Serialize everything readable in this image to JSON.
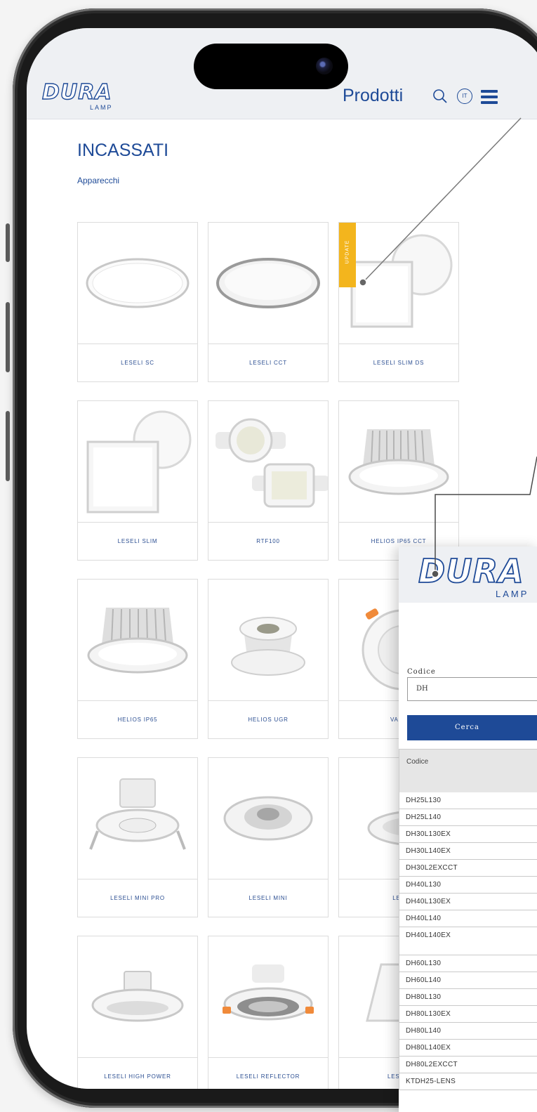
{
  "header": {
    "logo_text": "DURA",
    "logo_sub": "LAMP",
    "nav_title": "Prodotti",
    "lang_label": "IT"
  },
  "page": {
    "title": "INCASSATI",
    "breadcrumb": "Apparecchi"
  },
  "products": [
    {
      "label": "LESELI SC"
    },
    {
      "label": "LESELI CCT"
    },
    {
      "label": "LESELI SLIM DS",
      "badge": "UPDATE"
    },
    {
      "label": "LESELI SLIM"
    },
    {
      "label": "RTF100"
    },
    {
      "label": "HELIOS IP65 CCT"
    },
    {
      "label": "HELIOS IP65"
    },
    {
      "label": "HELIOS UGR"
    },
    {
      "label": "VALO"
    },
    {
      "label": "LESELI MINI PRO"
    },
    {
      "label": "LESELI MINI"
    },
    {
      "label": "LES"
    },
    {
      "label": "LESELI HIGH POWER"
    },
    {
      "label": "LESELI REFLECTOR"
    },
    {
      "label": "LESELI"
    }
  ],
  "search_panel": {
    "logo_text": "DURA",
    "logo_sub": "LAMP",
    "field_label": "Codice",
    "field_value": "DH",
    "button_label": "Cerca",
    "column_header": "Codice",
    "rows": [
      "DH25L130",
      "DH25L140",
      "DH30L130EX",
      "DH30L140EX",
      "DH30L2EXCCT",
      "DH40L130",
      "DH40L130EX",
      "DH40L140",
      "DH40L140EX",
      "DH60L130",
      "DH60L140",
      "DH80L130",
      "DH80L130EX",
      "DH80L140",
      "DH80L140EX",
      "DH80L2EXCCT",
      "KTDH25-LENS"
    ]
  },
  "colors": {
    "brand_blue": "#1e4a97",
    "update_badge": "#f3b51d"
  }
}
